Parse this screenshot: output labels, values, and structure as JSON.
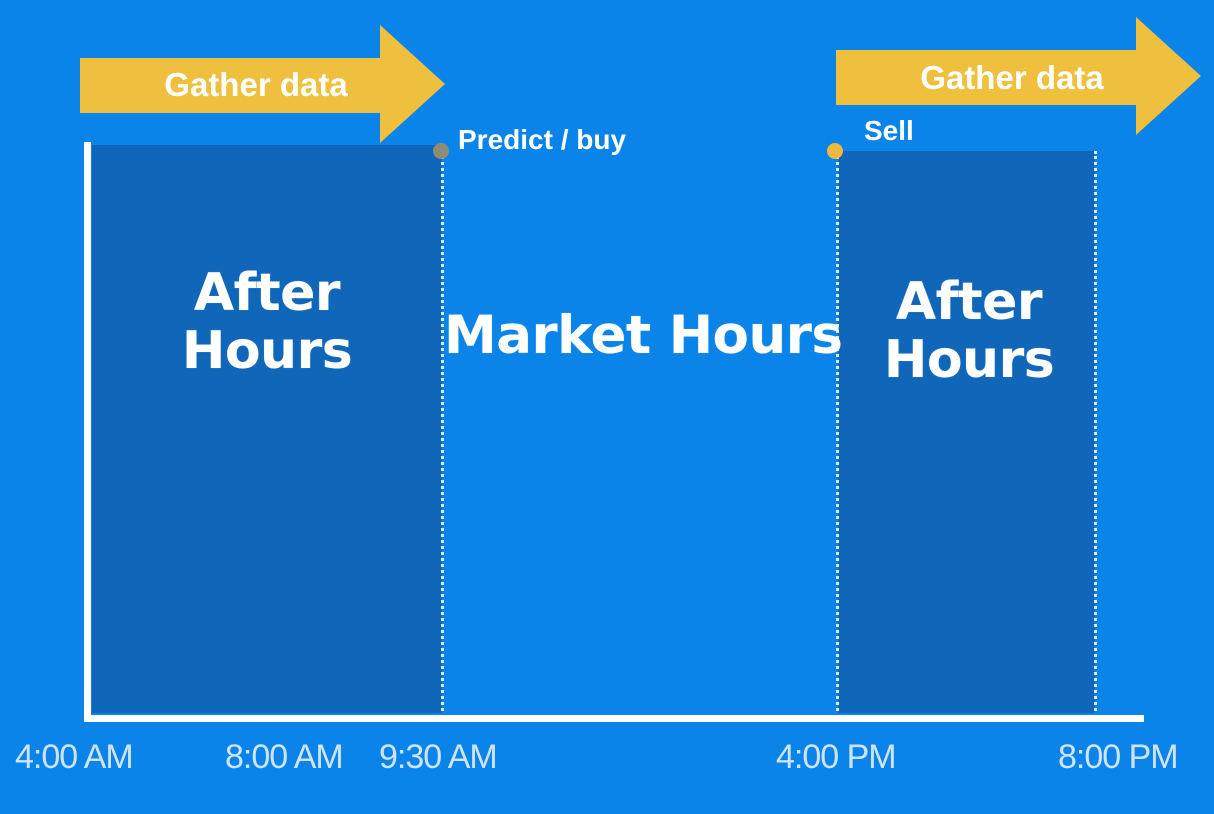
{
  "colors": {
    "background": "#0a84e8",
    "after_hours_region": "#1066b8",
    "gather_arrow": "#efbf3e",
    "buy_dot": "#8d8d73",
    "sell_dot": "#efb83e",
    "axis": "#ffffff",
    "text": "#ffffff",
    "tick_text": "#cfe3fb"
  },
  "arrows": [
    {
      "label": "Gather data",
      "icon": "right-arrow-icon"
    },
    {
      "label": "Gather data",
      "icon": "right-arrow-icon"
    }
  ],
  "events": {
    "buy": "Predict / buy",
    "sell": "Sell"
  },
  "regions": {
    "after_left": {
      "line1": "After",
      "line2": "Hours"
    },
    "market": "Market Hours",
    "after_right": {
      "line1": "After",
      "line2": "Hours"
    }
  },
  "time_ticks": [
    "4:00 AM",
    "8:00 AM",
    "9:30 AM",
    "4:00 PM",
    "8:00 PM"
  ]
}
